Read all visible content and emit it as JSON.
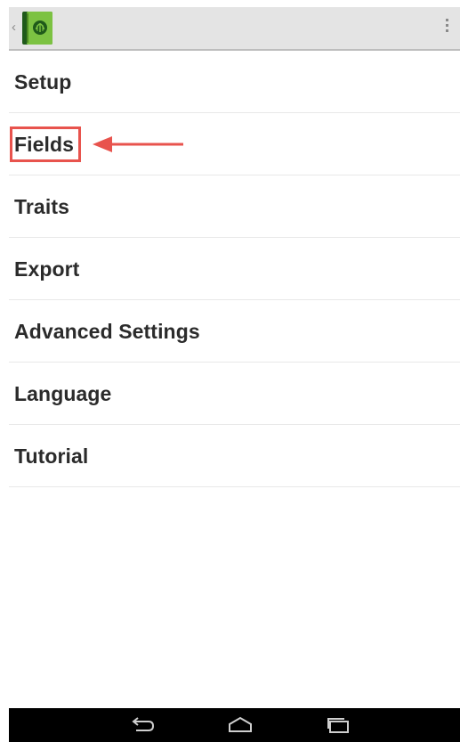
{
  "action_bar": {
    "back_glyph": "‹",
    "app_icon": "field-book-app-icon",
    "overflow_icon": "overflow-menu-icon"
  },
  "menu": {
    "items": [
      {
        "label": "Setup"
      },
      {
        "label": "Fields",
        "highlighted": true
      },
      {
        "label": "Traits"
      },
      {
        "label": "Export"
      },
      {
        "label": "Advanced Settings"
      },
      {
        "label": "Language"
      },
      {
        "label": "Tutorial"
      }
    ]
  },
  "annotation": {
    "color": "#e8534d",
    "target": "Fields"
  },
  "nav_bar": {
    "back_icon": "back-icon",
    "home_icon": "home-icon",
    "recents_icon": "recent-apps-icon"
  },
  "colors": {
    "action_bar_bg": "#e4e4e4",
    "app_icon_green": "#7cc242",
    "text": "#2b2b2b",
    "nav_bar_bg": "#000000"
  }
}
